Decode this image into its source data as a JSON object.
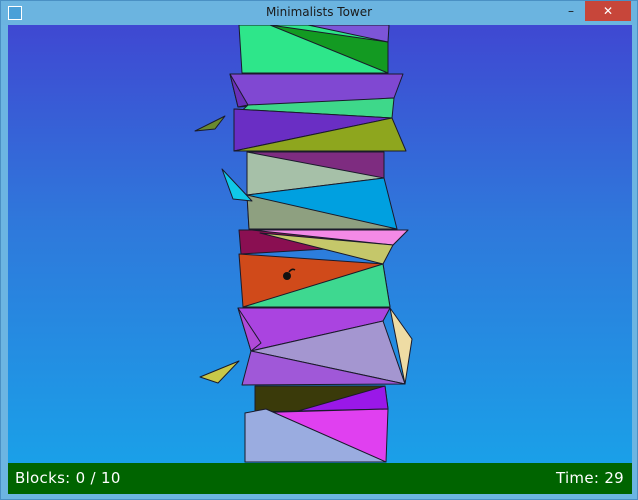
{
  "window": {
    "title": "Minimalists Tower",
    "minimize_glyph": "–",
    "maximize_glyph": "▫",
    "close_glyph": "✕"
  },
  "status": {
    "blocks_label": "Blocks:",
    "blocks_current": "0",
    "blocks_separator": "/",
    "blocks_total": "10",
    "time_label": "Time:",
    "time_value": "29"
  },
  "colors": {
    "sky_top": "#3f48d2",
    "sky_bottom": "#1aa0e8",
    "ground": "#006400",
    "close_button": "#c7463a"
  }
}
